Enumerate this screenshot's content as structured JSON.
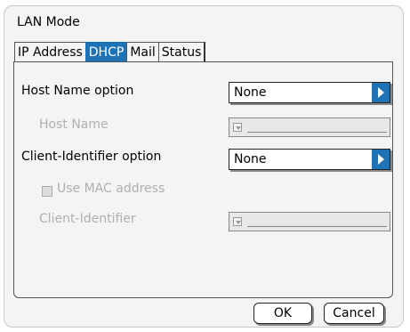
{
  "window": {
    "title": "LAN Mode"
  },
  "tabs": [
    {
      "label": "IP Address"
    },
    {
      "label": "DHCP"
    },
    {
      "label": "Mail"
    },
    {
      "label": "Status"
    }
  ],
  "form": {
    "host_name_option_label": "Host Name option",
    "host_name_option_value": "None",
    "host_name_label": "Host Name",
    "client_identifier_option_label": "Client-Identifier option",
    "client_identifier_option_value": "None",
    "use_mac_label": "Use MAC address",
    "client_identifier_label": "Client-Identifier"
  },
  "buttons": {
    "ok": "OK",
    "cancel": "Cancel"
  },
  "colors": {
    "accent": "#1e72b6",
    "disabled_text": "#b0b0b0"
  }
}
